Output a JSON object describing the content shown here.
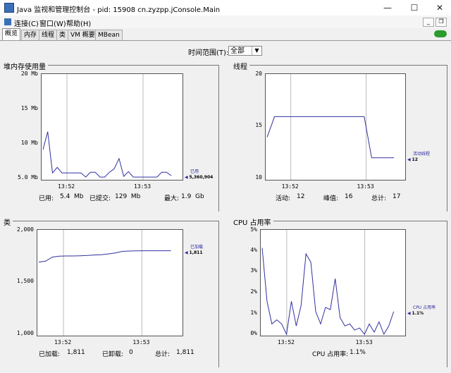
{
  "window": {
    "title": "Java 监视和管理控制台 - pid: 15908 cn.zyzpp.jConsole.Main",
    "minimize": "—",
    "maximize": "☐",
    "close": "✕"
  },
  "menu": {
    "items": [
      "连接(C)",
      "窗口(W)",
      "帮助(H)"
    ]
  },
  "tabs": [
    "概览",
    "内存",
    "线程",
    "类",
    "VM 概要",
    "MBean"
  ],
  "time_range": {
    "label": "时间范围(T):",
    "value": "全部"
  },
  "panels": {
    "heap": {
      "title": "堆内存使用量",
      "yticks": [
        "20 Mb",
        "15 Mb",
        "10 Mb",
        "5.0 Mb"
      ],
      "xticks": [
        "13:52",
        "13:53"
      ],
      "legend_name": "已用",
      "legend_value": "5,360,904",
      "footer": {
        "used_label": "已用:",
        "used_value": "5.4  Mb",
        "committed_label": "已提交:",
        "committed_value": "129  Mb",
        "max_label": "最大:",
        "max_value": "1.9  Gb"
      }
    },
    "threads": {
      "title": "线程",
      "yticks": [
        "20",
        "15",
        "10"
      ],
      "xticks": [
        "13:52",
        "13:53"
      ],
      "legend_name": "活动线程",
      "legend_value": "12",
      "footer": {
        "live_label": "活动:",
        "live_value": "12",
        "peak_label": "峰值:",
        "peak_value": "16",
        "total_label": "总计:",
        "total_value": "17"
      }
    },
    "classes": {
      "title": "类",
      "yticks": [
        "2,000",
        "1,500",
        "1,000"
      ],
      "xticks": [
        "13:52",
        "13:53"
      ],
      "legend_name": "已加载",
      "legend_value": "1,811",
      "footer": {
        "loaded_label": "已加载:",
        "loaded_value": "1,811",
        "unloaded_label": "已卸载:",
        "unloaded_value": "0",
        "total_label": "总计:",
        "total_value": "1,811"
      }
    },
    "cpu": {
      "title": "CPU 占用率",
      "yticks": [
        "5%",
        "4%",
        "3%",
        "2%",
        "1%",
        "0%"
      ],
      "xticks": [
        "13:52",
        "13:53"
      ],
      "legend_name": "CPU 占用率",
      "legend_value": "1.1%",
      "footer": {
        "label": "CPU 占用率:",
        "value": "1.1%"
      }
    }
  },
  "chart_data": [
    {
      "type": "line",
      "title": "堆内存使用量",
      "ylim": [
        5,
        20
      ],
      "series": [
        {
          "name": "已用",
          "values": [
            9.2,
            11.8,
            5.8,
            6.6,
            5.8,
            5.8,
            5.8,
            5.8,
            5.8,
            5.2,
            5.9,
            5.9,
            5.2,
            5.2,
            5.9,
            6.4,
            7.9,
            5.3,
            6.0,
            5.2,
            5.2,
            5.2,
            5.2,
            5.2,
            5.2,
            5.9,
            5.9,
            5.4
          ]
        }
      ],
      "color": "#3030a0"
    },
    {
      "type": "line",
      "title": "线程",
      "ylim": [
        10,
        20
      ],
      "series": [
        {
          "name": "活动线程",
          "values": [
            14,
            16,
            16,
            16,
            16,
            16,
            16,
            16,
            16,
            16,
            16,
            16,
            16,
            16,
            12,
            12,
            12,
            12
          ]
        }
      ],
      "color": "#3030a0"
    },
    {
      "type": "line",
      "title": "类",
      "ylim": [
        1000,
        2000
      ],
      "series": [
        {
          "name": "已加载",
          "values": [
            1700,
            1710,
            1750,
            1758,
            1760,
            1760,
            1762,
            1765,
            1770,
            1772,
            1780,
            1790,
            1805,
            1808,
            1810,
            1811,
            1811,
            1811,
            1811,
            1811
          ]
        }
      ],
      "color": "#3030a0"
    },
    {
      "type": "line",
      "title": "CPU 占用率",
      "ylim": [
        0,
        5
      ],
      "series": [
        {
          "name": "CPU 占用率",
          "values": [
            4.2,
            1.6,
            0.5,
            0.7,
            0.5,
            0.0,
            1.6,
            0.4,
            1.4,
            3.9,
            3.5,
            1.1,
            0.5,
            1.3,
            1.2,
            2.7,
            0.8,
            0.4,
            0.5,
            0.2,
            0.3,
            0.0,
            0.5,
            0.1,
            0.6,
            0.0,
            0.4,
            1.1
          ]
        }
      ],
      "color": "#3030a0"
    }
  ]
}
